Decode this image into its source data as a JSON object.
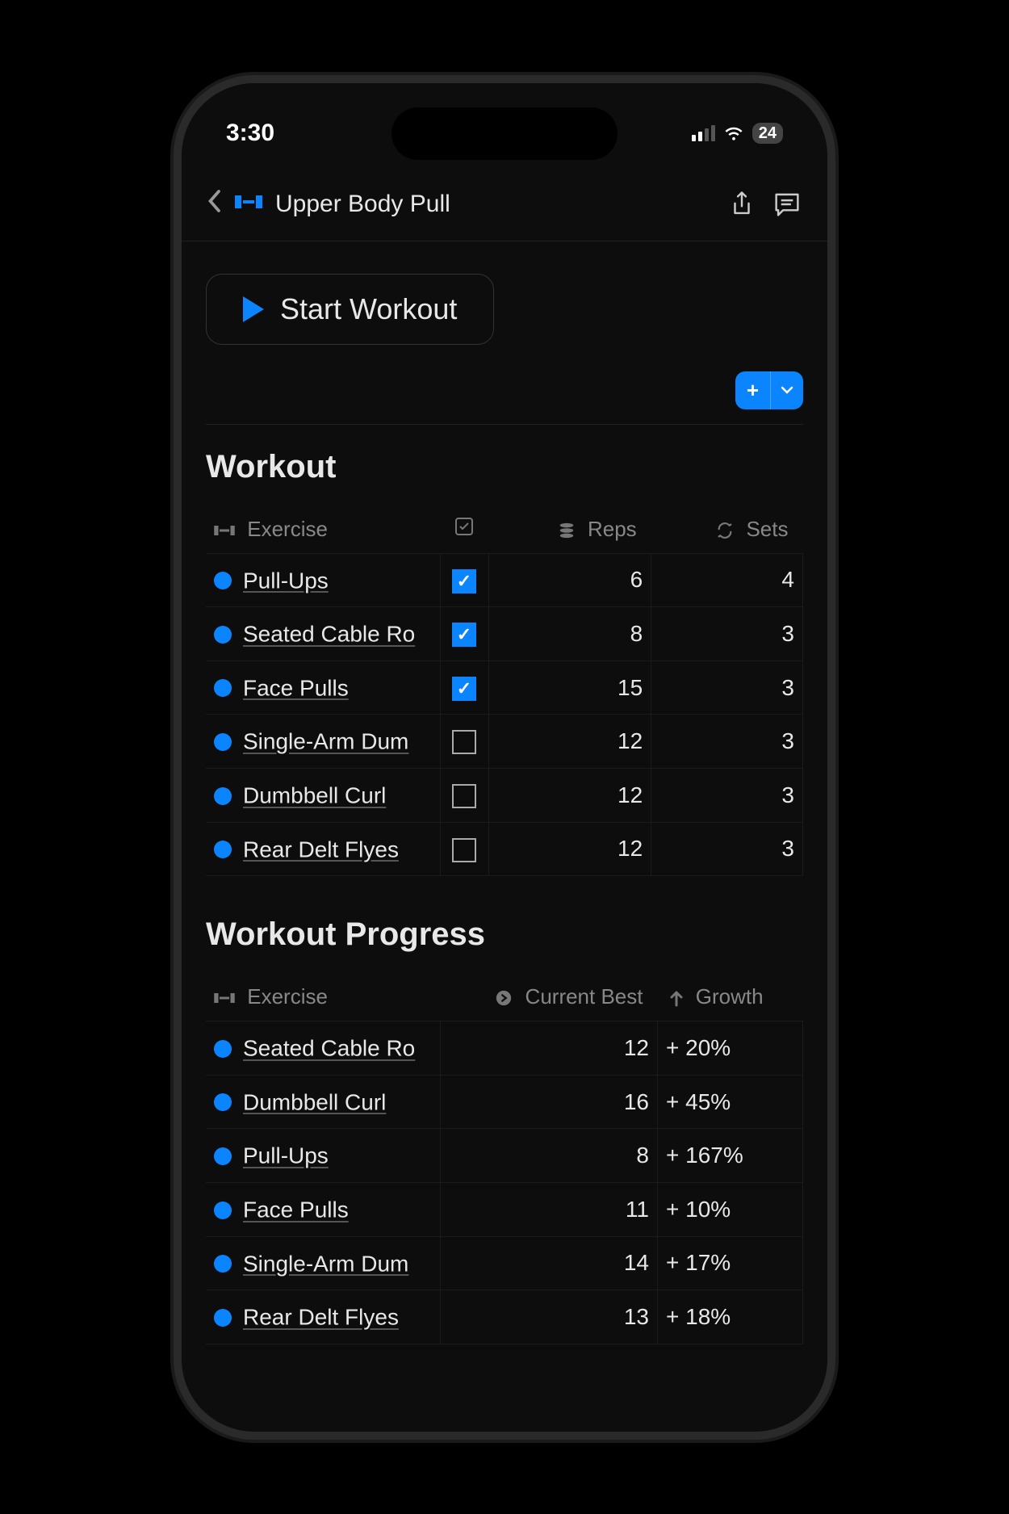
{
  "status": {
    "time": "3:30",
    "battery": "24"
  },
  "header": {
    "title": "Upper Body Pull"
  },
  "start_button": "Start Workout",
  "sections": {
    "workout": {
      "title": "Workout",
      "headers": {
        "exercise": "Exercise",
        "reps": "Reps",
        "sets": "Sets"
      },
      "rows": [
        {
          "name": "Pull-Ups",
          "checked": true,
          "reps": "6",
          "sets": "4"
        },
        {
          "name": "Seated Cable Ro",
          "checked": true,
          "reps": "8",
          "sets": "3"
        },
        {
          "name": "Face Pulls",
          "checked": true,
          "reps": "15",
          "sets": "3"
        },
        {
          "name": "Single-Arm Dum",
          "checked": false,
          "reps": "12",
          "sets": "3"
        },
        {
          "name": "Dumbbell Curl",
          "checked": false,
          "reps": "12",
          "sets": "3"
        },
        {
          "name": "Rear Delt Flyes",
          "checked": false,
          "reps": "12",
          "sets": "3"
        }
      ]
    },
    "progress": {
      "title": "Workout Progress",
      "headers": {
        "exercise": "Exercise",
        "best": "Current Best",
        "growth": "Growth"
      },
      "rows": [
        {
          "name": "Seated Cable Ro",
          "best": "12",
          "growth": "+ 20%"
        },
        {
          "name": "Dumbbell Curl",
          "best": "16",
          "growth": "+ 45%"
        },
        {
          "name": "Pull-Ups",
          "best": "8",
          "growth": "+ 167%"
        },
        {
          "name": "Face Pulls",
          "best": "11",
          "growth": "+ 10%"
        },
        {
          "name": "Single-Arm Dum",
          "best": "14",
          "growth": "+ 17%"
        },
        {
          "name": "Rear Delt Flyes",
          "best": "13",
          "growth": "+ 18%"
        }
      ]
    }
  }
}
